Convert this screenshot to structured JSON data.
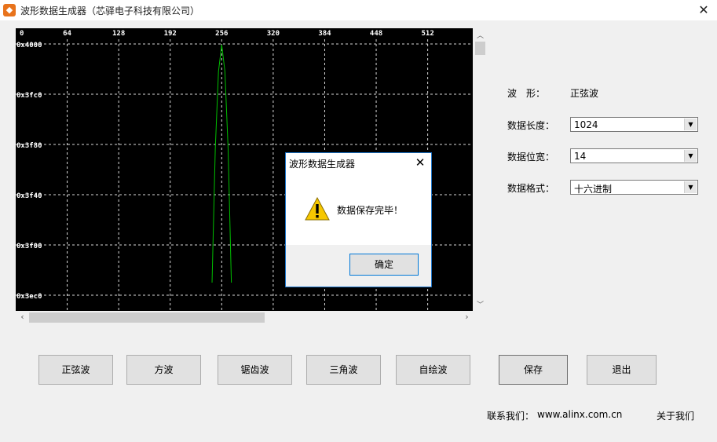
{
  "window": {
    "title": "波形数据生成器（芯驿电子科技有限公司）",
    "app_icon": "wave-app-icon",
    "close_glyph": "✕"
  },
  "colors": {
    "plot_bg": "#000000",
    "grid": "#ffffff",
    "wave": "#00c000",
    "dialog_border": "#1a73c9"
  },
  "plot": {
    "x_ticks": [
      "0",
      "64",
      "128",
      "192",
      "256",
      "320",
      "384",
      "448",
      "512"
    ],
    "y_ticks": [
      "0x4000",
      "0x3fc0",
      "0x3f80",
      "0x3f40",
      "0x3f00",
      "0x3ec0"
    ]
  },
  "chart_data": {
    "type": "line",
    "grid": true,
    "x_range": [
      0,
      568
    ],
    "y_range": [
      16080,
      16389
    ],
    "x": [
      244,
      248,
      252,
      256,
      260,
      264,
      268
    ],
    "y": [
      16080,
      16250,
      16349,
      16383,
      16349,
      16250,
      16080
    ],
    "xlabel": "",
    "ylabel": "",
    "title": ""
  },
  "panel": {
    "wave_label": "波　形：",
    "wave_value": "正弦波",
    "length_label": "数据长度：",
    "length_value": "1024",
    "width_label": "数据位宽：",
    "width_value": "14",
    "format_label": "数据格式：",
    "format_value": "十六进制"
  },
  "buttons": {
    "sine": "正弦波",
    "square": "方波",
    "sawtooth": "锯齿波",
    "triangle": "三角波",
    "custom": "自绘波",
    "save": "保存",
    "exit": "退出"
  },
  "footer": {
    "contact_label": "联系我们：",
    "contact_url": "www.alinx.com.cn",
    "about": "关于我们"
  },
  "dialog": {
    "title": "波形数据生成器",
    "message": "数据保存完毕！",
    "ok": "确定",
    "icon": "warning-icon",
    "close_glyph": "✕"
  }
}
